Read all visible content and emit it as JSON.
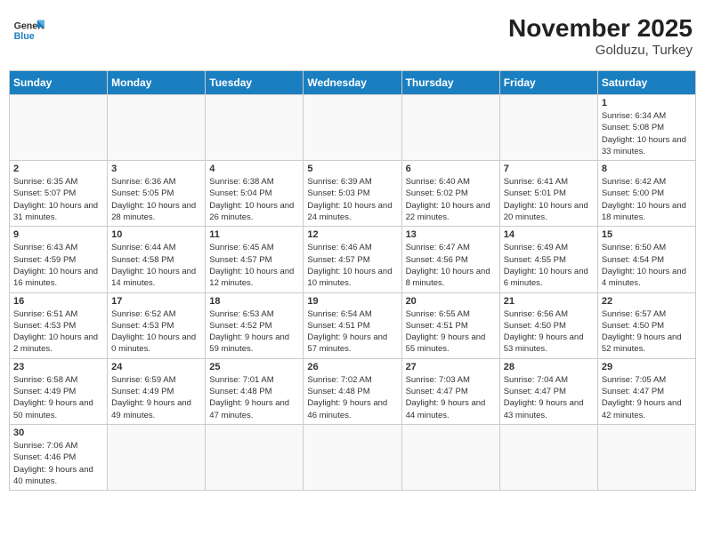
{
  "header": {
    "logo_general": "General",
    "logo_blue": "Blue",
    "title": "November 2025",
    "subtitle": "Golduzu, Turkey"
  },
  "days_of_week": [
    "Sunday",
    "Monday",
    "Tuesday",
    "Wednesday",
    "Thursday",
    "Friday",
    "Saturday"
  ],
  "weeks": [
    [
      {
        "day": "",
        "info": "",
        "empty": true
      },
      {
        "day": "",
        "info": "",
        "empty": true
      },
      {
        "day": "",
        "info": "",
        "empty": true
      },
      {
        "day": "",
        "info": "",
        "empty": true
      },
      {
        "day": "",
        "info": "",
        "empty": true
      },
      {
        "day": "",
        "info": "",
        "empty": true
      },
      {
        "day": "1",
        "info": "Sunrise: 6:34 AM\nSunset: 5:08 PM\nDaylight: 10 hours and 33 minutes."
      }
    ],
    [
      {
        "day": "2",
        "info": "Sunrise: 6:35 AM\nSunset: 5:07 PM\nDaylight: 10 hours and 31 minutes."
      },
      {
        "day": "3",
        "info": "Sunrise: 6:36 AM\nSunset: 5:05 PM\nDaylight: 10 hours and 28 minutes."
      },
      {
        "day": "4",
        "info": "Sunrise: 6:38 AM\nSunset: 5:04 PM\nDaylight: 10 hours and 26 minutes."
      },
      {
        "day": "5",
        "info": "Sunrise: 6:39 AM\nSunset: 5:03 PM\nDaylight: 10 hours and 24 minutes."
      },
      {
        "day": "6",
        "info": "Sunrise: 6:40 AM\nSunset: 5:02 PM\nDaylight: 10 hours and 22 minutes."
      },
      {
        "day": "7",
        "info": "Sunrise: 6:41 AM\nSunset: 5:01 PM\nDaylight: 10 hours and 20 minutes."
      },
      {
        "day": "8",
        "info": "Sunrise: 6:42 AM\nSunset: 5:00 PM\nDaylight: 10 hours and 18 minutes."
      }
    ],
    [
      {
        "day": "9",
        "info": "Sunrise: 6:43 AM\nSunset: 4:59 PM\nDaylight: 10 hours and 16 minutes."
      },
      {
        "day": "10",
        "info": "Sunrise: 6:44 AM\nSunset: 4:58 PM\nDaylight: 10 hours and 14 minutes."
      },
      {
        "day": "11",
        "info": "Sunrise: 6:45 AM\nSunset: 4:57 PM\nDaylight: 10 hours and 12 minutes."
      },
      {
        "day": "12",
        "info": "Sunrise: 6:46 AM\nSunset: 4:57 PM\nDaylight: 10 hours and 10 minutes."
      },
      {
        "day": "13",
        "info": "Sunrise: 6:47 AM\nSunset: 4:56 PM\nDaylight: 10 hours and 8 minutes."
      },
      {
        "day": "14",
        "info": "Sunrise: 6:49 AM\nSunset: 4:55 PM\nDaylight: 10 hours and 6 minutes."
      },
      {
        "day": "15",
        "info": "Sunrise: 6:50 AM\nSunset: 4:54 PM\nDaylight: 10 hours and 4 minutes."
      }
    ],
    [
      {
        "day": "16",
        "info": "Sunrise: 6:51 AM\nSunset: 4:53 PM\nDaylight: 10 hours and 2 minutes."
      },
      {
        "day": "17",
        "info": "Sunrise: 6:52 AM\nSunset: 4:53 PM\nDaylight: 10 hours and 0 minutes."
      },
      {
        "day": "18",
        "info": "Sunrise: 6:53 AM\nSunset: 4:52 PM\nDaylight: 9 hours and 59 minutes."
      },
      {
        "day": "19",
        "info": "Sunrise: 6:54 AM\nSunset: 4:51 PM\nDaylight: 9 hours and 57 minutes."
      },
      {
        "day": "20",
        "info": "Sunrise: 6:55 AM\nSunset: 4:51 PM\nDaylight: 9 hours and 55 minutes."
      },
      {
        "day": "21",
        "info": "Sunrise: 6:56 AM\nSunset: 4:50 PM\nDaylight: 9 hours and 53 minutes."
      },
      {
        "day": "22",
        "info": "Sunrise: 6:57 AM\nSunset: 4:50 PM\nDaylight: 9 hours and 52 minutes."
      }
    ],
    [
      {
        "day": "23",
        "info": "Sunrise: 6:58 AM\nSunset: 4:49 PM\nDaylight: 9 hours and 50 minutes."
      },
      {
        "day": "24",
        "info": "Sunrise: 6:59 AM\nSunset: 4:49 PM\nDaylight: 9 hours and 49 minutes."
      },
      {
        "day": "25",
        "info": "Sunrise: 7:01 AM\nSunset: 4:48 PM\nDaylight: 9 hours and 47 minutes."
      },
      {
        "day": "26",
        "info": "Sunrise: 7:02 AM\nSunset: 4:48 PM\nDaylight: 9 hours and 46 minutes."
      },
      {
        "day": "27",
        "info": "Sunrise: 7:03 AM\nSunset: 4:47 PM\nDaylight: 9 hours and 44 minutes."
      },
      {
        "day": "28",
        "info": "Sunrise: 7:04 AM\nSunset: 4:47 PM\nDaylight: 9 hours and 43 minutes."
      },
      {
        "day": "29",
        "info": "Sunrise: 7:05 AM\nSunset: 4:47 PM\nDaylight: 9 hours and 42 minutes."
      }
    ],
    [
      {
        "day": "30",
        "info": "Sunrise: 7:06 AM\nSunset: 4:46 PM\nDaylight: 9 hours and 40 minutes."
      },
      {
        "day": "",
        "info": "",
        "empty": true
      },
      {
        "day": "",
        "info": "",
        "empty": true
      },
      {
        "day": "",
        "info": "",
        "empty": true
      },
      {
        "day": "",
        "info": "",
        "empty": true
      },
      {
        "day": "",
        "info": "",
        "empty": true
      },
      {
        "day": "",
        "info": "",
        "empty": true
      }
    ]
  ]
}
